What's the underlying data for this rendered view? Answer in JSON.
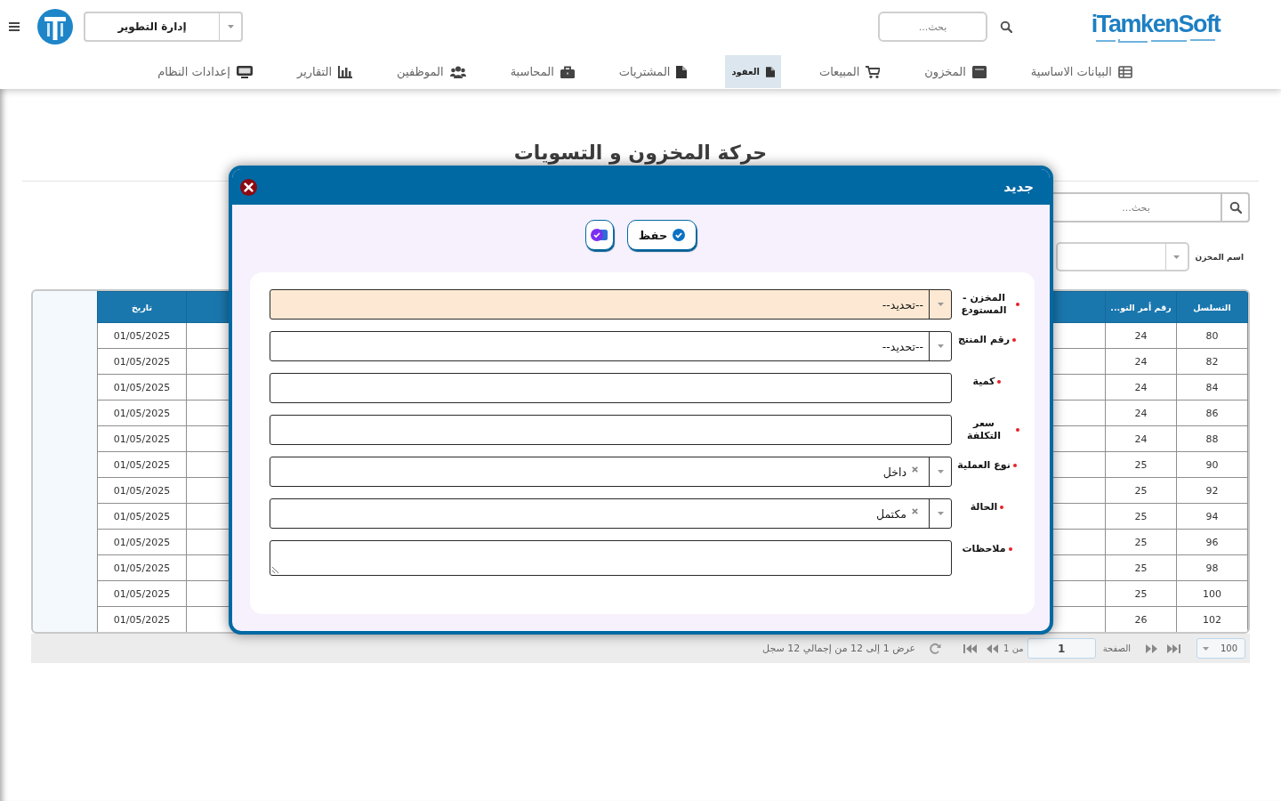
{
  "header": {
    "department_select": {
      "value": "إدارة التطوير"
    },
    "search": {
      "placeholder": "بحث..."
    },
    "logo_text": "iTamkenSoft"
  },
  "nav": [
    {
      "label": "البيانات الاساسية",
      "selected": false
    },
    {
      "label": "المخزون",
      "selected": false
    },
    {
      "label": "المبيعات",
      "selected": false
    },
    {
      "label": "العقود",
      "selected": true
    },
    {
      "label": "المشتريات",
      "selected": false
    },
    {
      "label": "المحاسبة",
      "selected": false
    },
    {
      "label": "الموظفين",
      "selected": false
    },
    {
      "label": "التقارير",
      "selected": false
    },
    {
      "label": "إعدادات النظام",
      "selected": false
    }
  ],
  "page": {
    "title": "حركة المخزون و التسويات",
    "search": {
      "placeholder": "بحث..."
    },
    "filter": {
      "label": "اسم المخزن"
    }
  },
  "table": {
    "columns": [
      "التسلسل",
      "رقم أمر التو...",
      "تاريخ"
    ],
    "rows": [
      [
        "80",
        "24",
        "01/05/2025"
      ],
      [
        "82",
        "24",
        "01/05/2025"
      ],
      [
        "84",
        "24",
        "01/05/2025"
      ],
      [
        "86",
        "24",
        "01/05/2025"
      ],
      [
        "88",
        "24",
        "01/05/2025"
      ],
      [
        "90",
        "25",
        "01/05/2025"
      ],
      [
        "92",
        "25",
        "01/05/2025"
      ],
      [
        "94",
        "25",
        "01/05/2025"
      ],
      [
        "96",
        "25",
        "01/05/2025"
      ],
      [
        "98",
        "25",
        "01/05/2025"
      ],
      [
        "100",
        "25",
        "01/05/2025"
      ],
      [
        "102",
        "26",
        "01/05/2025"
      ]
    ]
  },
  "pager": {
    "page_size": "100",
    "page_label": "الصفحة",
    "page": "1",
    "page_count": "من 1",
    "summary": "عرض 1 إلى 12 من إجمالي 12 سجل"
  },
  "dialog": {
    "title": "جديد",
    "buttons": [
      {
        "kind": "save",
        "label": "حفظ"
      },
      {
        "kind": "icon"
      }
    ],
    "fields": [
      {
        "kind": "select",
        "label": "المخزن - المستودع",
        "required": true,
        "focused": true,
        "placeholder": "--تحديد--"
      },
      {
        "kind": "select",
        "label": "رقم المنتج",
        "required": true,
        "focused": false,
        "placeholder": "--تحديد--"
      },
      {
        "kind": "input",
        "label": "كمية",
        "required": true,
        "focused": false
      },
      {
        "kind": "input",
        "label": "سعر التكلفة",
        "required": true,
        "focused": false
      },
      {
        "kind": "select",
        "label": "نوع العملية",
        "required": true,
        "focused": false,
        "value": "داخل"
      },
      {
        "kind": "select",
        "label": "الحالة",
        "required": true,
        "focused": false,
        "value": "مكتمل"
      },
      {
        "kind": "textarea",
        "label": "ملاحظات",
        "required": true,
        "focused": false
      }
    ]
  }
}
